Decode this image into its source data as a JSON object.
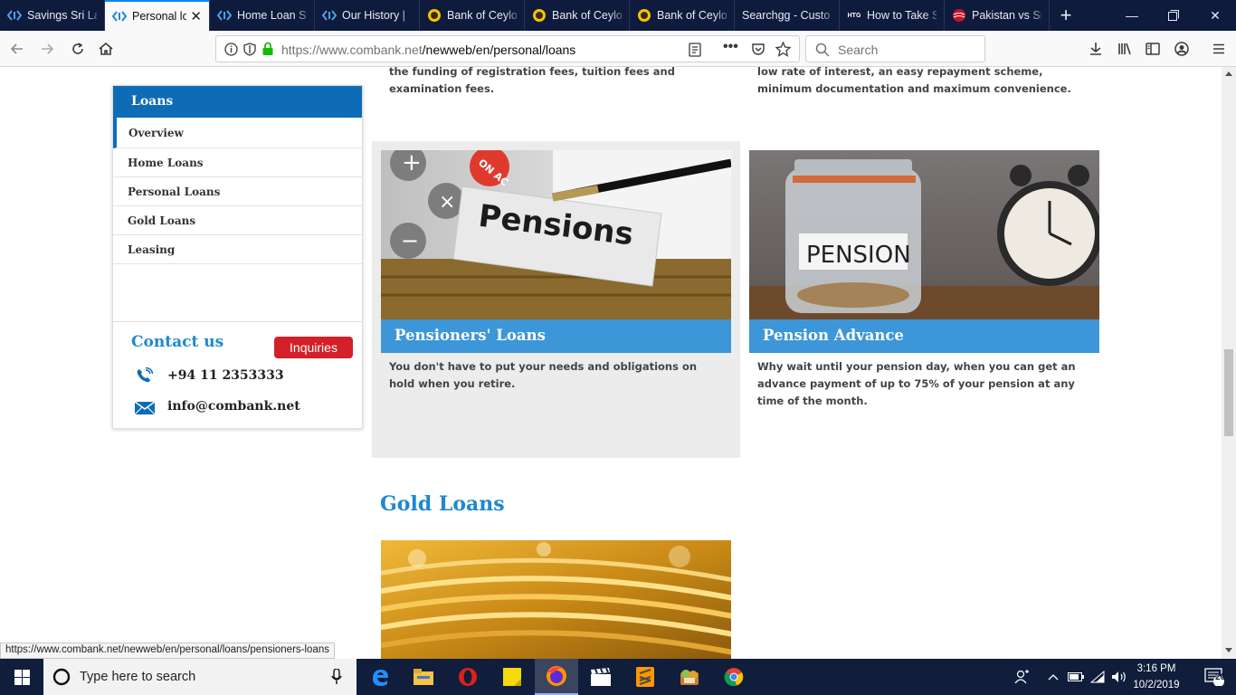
{
  "browser": {
    "tabs": [
      {
        "label": "Savings Sri La",
        "icon": "combank-icon",
        "active": false
      },
      {
        "label": "Personal lo",
        "icon": "combank-icon",
        "active": true
      },
      {
        "label": "Home Loan S",
        "icon": "combank-icon",
        "active": false
      },
      {
        "label": "Our History | ",
        "icon": "combank-icon",
        "active": false
      },
      {
        "label": "Bank of Ceylo",
        "icon": "boc-icon",
        "active": false
      },
      {
        "label": "Bank of Ceylo",
        "icon": "boc-icon",
        "active": false
      },
      {
        "label": "Bank of Ceylo",
        "icon": "boc-icon",
        "active": false
      },
      {
        "label": "Searchgg - Custo",
        "icon": "none",
        "active": false
      },
      {
        "label": "How to Take S",
        "icon": "htg-icon",
        "active": false
      },
      {
        "label": "Pakistan vs Sr",
        "icon": "cricket-icon",
        "active": false
      }
    ],
    "htg_badge": "HTG",
    "url_host": "https://www.combank.net",
    "url_path": "/newweb/en/personal/loans",
    "search_placeholder": "Search",
    "status_url": "https://www.combank.net/newweb/en/personal/loans/pensioners-loans"
  },
  "page": {
    "top_left_text": "the funding of registration fees, tuition fees and examination fees.",
    "top_right_text": "low rate of interest, an easy repayment scheme, minimum documentation and maximum convenience.",
    "sidebar": {
      "title": "Loans",
      "items": [
        "Overview",
        "Home Loans",
        "Personal Loans",
        "Gold Loans",
        "Leasing"
      ],
      "contact_title": "Contact us",
      "inquiries_label": "Inquiries",
      "phone": "+94 11 2353333",
      "email": "info@combank.net"
    },
    "cards": [
      {
        "title": "Pensioners' Loans",
        "description": "You don't have to put your needs and obligations on hold when you retire.",
        "image_text": "Pensions"
      },
      {
        "title": "Pension Advance",
        "description": "Why wait until your pension day, when you can get an advance payment of up to 75% of your pension at any time of the month.",
        "image_text": "PENSION"
      }
    ],
    "section_title": "Gold Loans",
    "calculator_key_text": "ON AC"
  },
  "taskbar": {
    "search_placeholder": "Type here to search",
    "time": "3:16 PM",
    "date": "10/2/2019",
    "notification_count": "20"
  }
}
